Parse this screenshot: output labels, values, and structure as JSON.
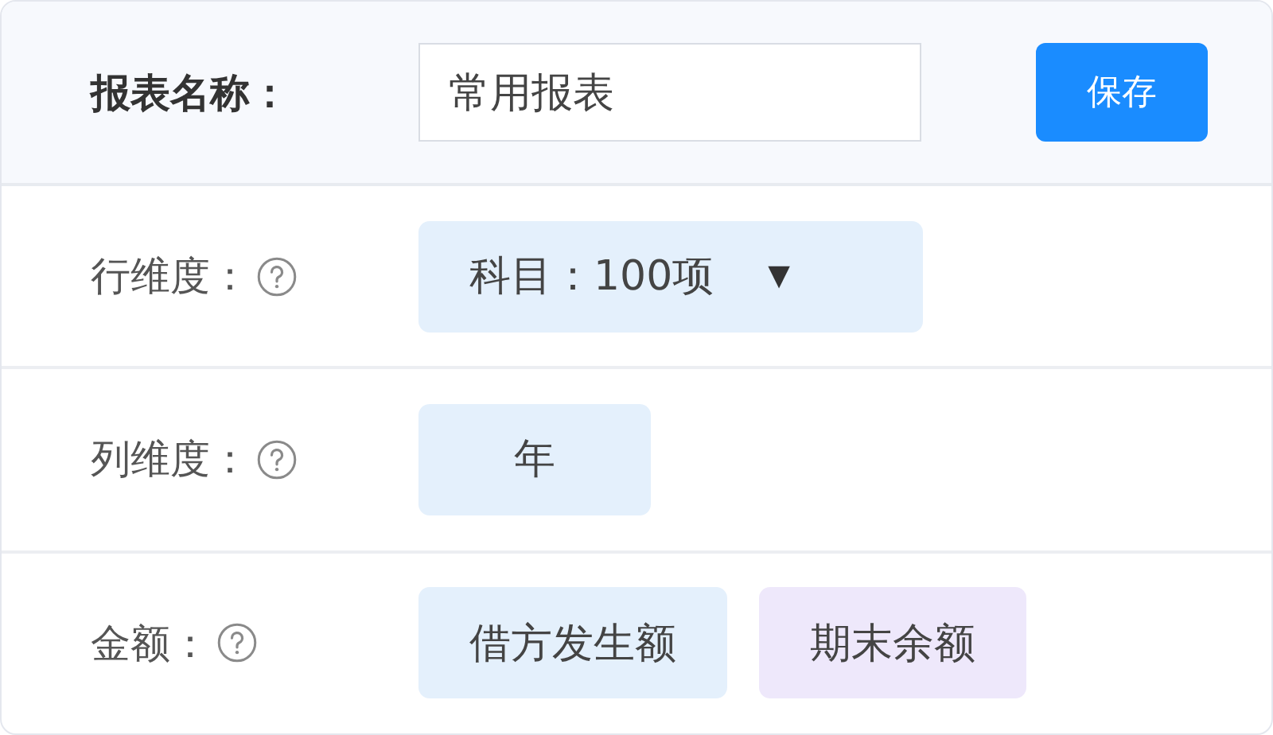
{
  "header": {
    "label": "报表名称：",
    "input_value": "常用报表",
    "save_button": "保存"
  },
  "rows": [
    {
      "label": "行维度：",
      "chips": [
        {
          "text": "科目：100项",
          "kind": "dropdown",
          "caret": "▼",
          "color": "#e4f0fc"
        }
      ]
    },
    {
      "label": "列维度：",
      "chips": [
        {
          "text": "年",
          "kind": "plain",
          "color": "#e4f0fc"
        }
      ]
    },
    {
      "label": "金额：",
      "chips": [
        {
          "text": "借方发生额",
          "kind": "plain",
          "color": "#e4f0fc"
        },
        {
          "text": "期末余额",
          "kind": "plain",
          "color": "#eee8fb"
        }
      ]
    }
  ]
}
